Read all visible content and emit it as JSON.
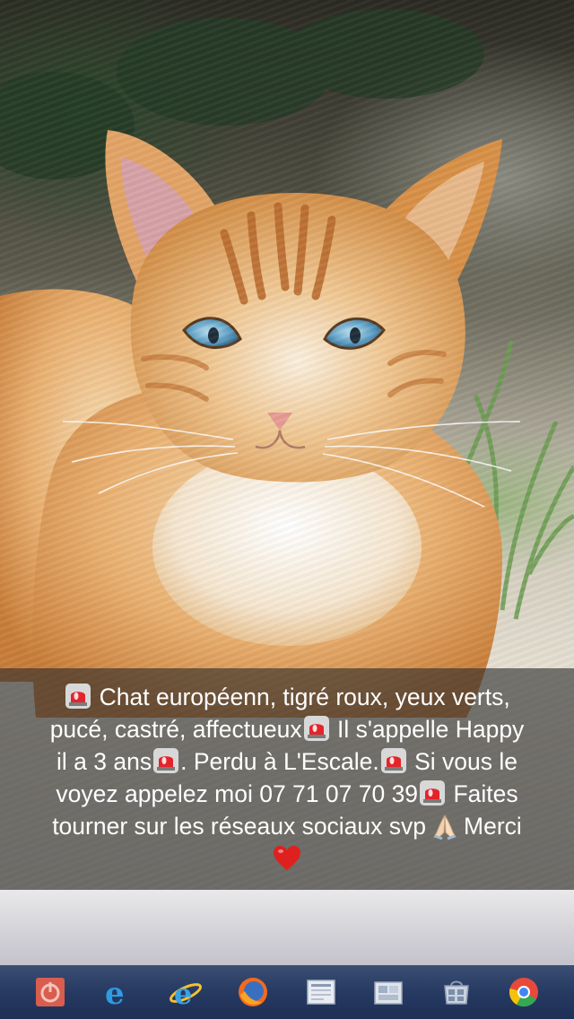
{
  "caption": {
    "line1": "Chat européenn, tigré roux, yeux verts,",
    "line2": "pucé, castré, affectueux",
    "line2b": "Il s'appelle Happy",
    "line3a": "il a 3 ans",
    "line3b": ". Perdu à L'Escale.",
    "line3c": "Si vous le",
    "line4a": "voyez appelez moi  07 71 07 70 39",
    "line4b": "Faites",
    "line5a": "tourner sur les réseaux sociaux svp",
    "line5b": "Merci"
  },
  "emoji": {
    "siren": "police-car-light-icon",
    "pray": "folded-hands-icon",
    "heart": "red-heart-icon"
  },
  "photo": {
    "subject": "orange-tabby-cat"
  },
  "taskbar": {
    "items": [
      {
        "name": "power-app-icon"
      },
      {
        "name": "edge-browser-icon"
      },
      {
        "name": "internet-explorer-icon"
      },
      {
        "name": "firefox-icon"
      },
      {
        "name": "document-app-icon"
      },
      {
        "name": "file-explorer-icon"
      },
      {
        "name": "store-app-icon"
      },
      {
        "name": "chrome-icon"
      }
    ]
  },
  "colors": {
    "caption_bg": "#2d2d2d",
    "caption_text": "#ffffff",
    "taskbar_bg": "#263a62",
    "cat_fur": "#e9a65a"
  }
}
